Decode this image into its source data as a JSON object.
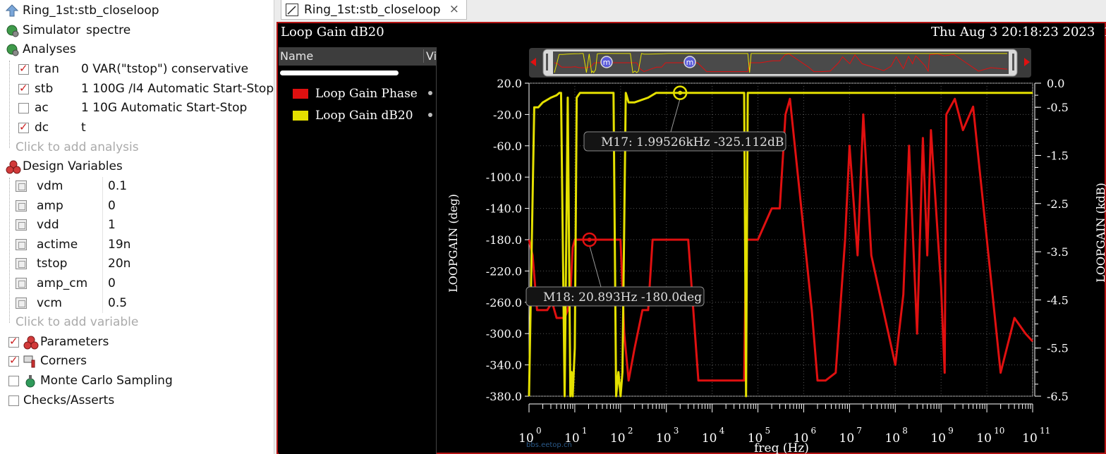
{
  "tree": {
    "top_item": "Ring_1st:stb_closeloop",
    "simulator_label": "Simulator",
    "simulator_value": "spectre",
    "analyses_label": "Analyses",
    "analyses": [
      {
        "name": "tran",
        "args": "0 VAR(\"tstop\") conservative",
        "checked": true
      },
      {
        "name": "stb",
        "args": "1 100G /I4 Automatic Start-Stop",
        "checked": true
      },
      {
        "name": "ac",
        "args": "1 10G Automatic Start-Stop",
        "checked": false
      },
      {
        "name": "dc",
        "args": "t",
        "checked": true
      }
    ],
    "add_analysis": "Click to add analysis",
    "design_variables_label": "Design Variables",
    "variables": [
      {
        "name": "vdm",
        "value": "0.1"
      },
      {
        "name": "amp",
        "value": "0"
      },
      {
        "name": "vdd",
        "value": "1"
      },
      {
        "name": "actime",
        "value": "19n"
      },
      {
        "name": "tstop",
        "value": "20n"
      },
      {
        "name": "amp_cm",
        "value": "0"
      },
      {
        "name": "vcm",
        "value": "0.5"
      }
    ],
    "add_variable": "Click to add variable",
    "sections": [
      {
        "label": "Parameters",
        "checked": true
      },
      {
        "label": "Corners",
        "checked": true
      },
      {
        "label": "Monte Carlo Sampling",
        "checked": false
      },
      {
        "label": "Checks/Asserts",
        "checked": false
      }
    ]
  },
  "tab": {
    "label": "Ring_1st:stb_closeloop",
    "close_glyph": "×"
  },
  "plot": {
    "title": "Loop Gain dB20",
    "datetime": "Thu Aug 3 20:18:23 2023",
    "subwindow": "1",
    "legend_header_name": "Name",
    "legend_header_col2": "Vi",
    "legend_items": [
      {
        "label": "Loop Gain Phase",
        "color": "#e01010"
      },
      {
        "label": "Loop Gain dB20",
        "color": "#e4e000"
      }
    ],
    "watermark": "bbs.eetop.cn"
  },
  "chart_data": {
    "type": "line",
    "xlabel": "freq (Hz)",
    "ylabel_left": "LOOPGAIN (deg)",
    "ylabel_right": "LOOPGAIN (kdB)",
    "x_scale": "log",
    "xlim": [
      1,
      100000000000
    ],
    "x_ticks": [
      {
        "exp": "0"
      },
      {
        "exp": "1"
      },
      {
        "exp": "2"
      },
      {
        "exp": "3"
      },
      {
        "exp": "4"
      },
      {
        "exp": "5"
      },
      {
        "exp": "6"
      },
      {
        "exp": "7"
      },
      {
        "exp": "8"
      },
      {
        "exp": "9"
      },
      {
        "exp": "10"
      },
      {
        "exp": "11"
      }
    ],
    "x_tick_base": "10",
    "ylim_left": [
      -380,
      20
    ],
    "y_ticks_left": [
      "20.0",
      "-20.0",
      "-60.0",
      "-100.0",
      "-140.0",
      "-180.0",
      "-220.0",
      "-260.0",
      "-300.0",
      "-340.0",
      "-380.0"
    ],
    "ylim_right": [
      -6.5,
      0
    ],
    "y_ticks_right": [
      "0.0",
      "-0.5",
      "-1.5",
      "-2.5",
      "-3.5",
      "-4.5",
      "-5.5",
      "-6.5"
    ],
    "grid": true,
    "series": [
      {
        "name": "Loop Gain Phase",
        "axis": "left",
        "color": "#e01010",
        "x": [
          1,
          1.2,
          1.5,
          2.5,
          3.2,
          4,
          5,
          6,
          7,
          8,
          9,
          10,
          12,
          20,
          50,
          80,
          100,
          120,
          150,
          200,
          300,
          400,
          500,
          1000,
          2000,
          3000,
          5000,
          8000,
          10000,
          20000,
          30000,
          50000,
          55000,
          100000,
          200000,
          300000,
          400000,
          500000,
          1000000,
          1500000,
          2000000,
          3000000,
          5000000,
          8000000,
          10000000,
          15000000,
          20000000,
          30000000,
          100000000,
          150000000,
          200000000,
          300000000,
          400000000,
          500000000,
          600000000,
          1000000000,
          1100000000,
          1200000000,
          1300000000,
          2000000000,
          3000000000,
          5000000000,
          10000000000,
          20000000000,
          40000000000,
          70000000000,
          100000000000
        ],
        "y": [
          -180,
          -200,
          -270,
          -270,
          -260,
          -280,
          -280,
          -280,
          -270,
          -250,
          -190,
          -180,
          -180,
          -180,
          -180,
          -180,
          -180,
          -300,
          -360,
          -320,
          -270,
          -270,
          -180,
          -180,
          -180,
          -180,
          -360,
          -360,
          -360,
          -360,
          -360,
          -360,
          -180,
          -180,
          -140,
          -140,
          -20,
          0,
          -170,
          -270,
          -360,
          -360,
          -350,
          -180,
          -60,
          -200,
          -20,
          -200,
          -340,
          -250,
          -60,
          -300,
          -50,
          -200,
          -40,
          -240,
          -300,
          -350,
          -20,
          0,
          -40,
          -10,
          -180,
          -350,
          -280,
          -300,
          -310
        ]
      },
      {
        "name": "Loop Gain dB20",
        "axis": "right",
        "color": "#e4e000",
        "x": [
          1,
          1.3,
          1.6,
          2,
          3,
          4,
          4.6,
          5,
          6,
          7,
          8,
          8.5,
          9,
          10,
          11,
          13,
          20,
          40,
          70,
          80,
          90,
          100,
          110,
          130,
          150,
          200,
          400,
          600,
          800,
          1000,
          1500,
          2000,
          3000,
          5000,
          10000,
          20000,
          40000,
          50000,
          55000,
          60000,
          70000,
          100000,
          10000000,
          100000000000
        ],
        "y": [
          -6.5,
          -0.5,
          -0.5,
          -0.4,
          -0.3,
          -0.25,
          -0.2,
          -0.2,
          -6.5,
          -0.3,
          -6.5,
          -6.0,
          -6.5,
          -5.5,
          -0.3,
          -0.2,
          -0.2,
          -0.2,
          -0.2,
          -6.5,
          -6.0,
          -6.5,
          -6.0,
          -0.2,
          -0.4,
          -0.4,
          -0.3,
          -0.2,
          -0.2,
          -0.2,
          -0.2,
          -0.2,
          -0.2,
          -0.2,
          -0.2,
          -0.2,
          -0.2,
          -0.2,
          -6.5,
          -0.2,
          -0.2,
          -0.2,
          -0.2,
          -0.2
        ]
      }
    ],
    "markers": [
      {
        "name": "M17",
        "label": "M17: 1.99526kHz -325.112dB",
        "x": 1995.26,
        "axis": "right",
        "y": -0.2,
        "color": "#e4e000"
      },
      {
        "name": "M18",
        "label": "M18: 20.893Hz -180.0deg",
        "x": 20.893,
        "axis": "left",
        "y": -180.0,
        "color": "#e01010"
      }
    ],
    "zoom_strip_markers": [
      "m",
      "m"
    ]
  }
}
